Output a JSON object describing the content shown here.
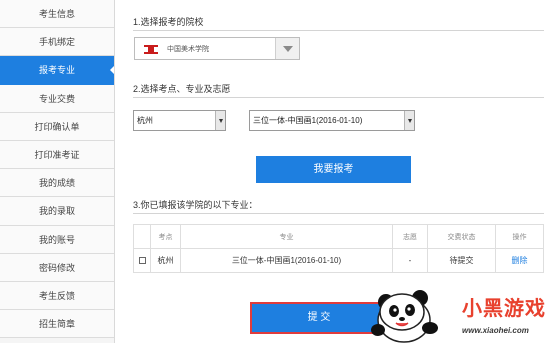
{
  "sidebar": {
    "items": [
      {
        "label": "考生信息",
        "active": false
      },
      {
        "label": "手机绑定",
        "active": false
      },
      {
        "label": "报考专业",
        "active": true
      },
      {
        "label": "专业交费",
        "active": false
      },
      {
        "label": "打印确认单",
        "active": false
      },
      {
        "label": "打印准考证",
        "active": false
      },
      {
        "label": "我的成绩",
        "active": false
      },
      {
        "label": "我的录取",
        "active": false
      },
      {
        "label": "我的账号",
        "active": false
      },
      {
        "label": "密码修改",
        "active": false
      },
      {
        "label": "考生反馈",
        "active": false
      },
      {
        "label": "招生简章",
        "active": false
      }
    ]
  },
  "main": {
    "step1_title": "1.选择报考的院校",
    "school_select": {
      "value": "中国美术学院",
      "logo": "school-logo"
    },
    "step2_title": "2.选择考点、专业及志愿",
    "exam_site_select": {
      "value": "杭州"
    },
    "major_select": {
      "value": "三位一体-中国画1(2016-01-10)"
    },
    "apply_button": "我要报考",
    "step3_title": "3.你已填报该学院的以下专业：",
    "table": {
      "headers": [
        "",
        "考点",
        "专业",
        "志愿",
        "交费状态",
        "操作"
      ],
      "rows": [
        {
          "checkbox": "",
          "site": "杭州",
          "major": "三位一体-中国画1(2016-01-10)",
          "choice": "-",
          "status": "待提交",
          "action": "删除"
        }
      ]
    },
    "submit_button": "提  交"
  },
  "watermark": {
    "logo_text": "小黑游戏",
    "url": "www.xiaohei.com"
  },
  "colors": {
    "accent": "#1e7fe0",
    "submit_outline": "#e03c3c",
    "school_red": "#c91c1c"
  }
}
